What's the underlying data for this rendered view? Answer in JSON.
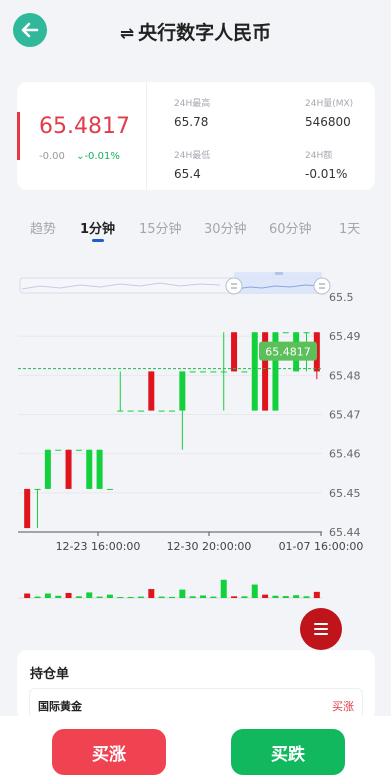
{
  "header": {
    "title": "央行数字人民币",
    "swap_glyph": "⇌",
    "back_icon": "arrow-left"
  },
  "quote": {
    "price": "65.4817",
    "change": "-0.00",
    "change_pct": "-0.01%",
    "stats": [
      {
        "label": "24H最高",
        "value": "65.78"
      },
      {
        "label": "24H量(MX)",
        "value": "546800"
      },
      {
        "label": "24H最低",
        "value": "65.4"
      },
      {
        "label": "24H额",
        "value": "-0.01%"
      }
    ]
  },
  "tabs": [
    {
      "label": "趋势",
      "active": false
    },
    {
      "label": "1分钟",
      "active": true
    },
    {
      "label": "15分钟",
      "active": false
    },
    {
      "label": "30分钟",
      "active": false
    },
    {
      "label": "60分钟",
      "active": false
    },
    {
      "label": "1天",
      "active": false
    }
  ],
  "colors": {
    "up": "#e0141c",
    "down": "#13d13c",
    "accent": "#1d5fc9",
    "back_button": "#2fb89a"
  },
  "chart_data": {
    "type": "candlestick",
    "y_ticks": [
      "65.5",
      "65.49",
      "65.48",
      "65.47",
      "65.46",
      "65.45",
      "65.44"
    ],
    "ylim": [
      65.44,
      65.5
    ],
    "x_ticks": [
      "12-23 16:00:00",
      "12-30 20:00:00",
      "01-07 16:00:00"
    ],
    "last_price_label": "65.4817",
    "last_price": 65.4817,
    "candles": [
      {
        "open": 65.441,
        "close": 65.451,
        "high": 65.451,
        "low": 65.441,
        "dir": "up"
      },
      {
        "open": 65.451,
        "close": 65.451,
        "high": 65.451,
        "low": 65.441,
        "dir": "flat"
      },
      {
        "open": 65.451,
        "close": 65.461,
        "high": 65.461,
        "low": 65.451,
        "dir": "down"
      },
      {
        "open": 65.461,
        "close": 65.461,
        "high": 65.461,
        "low": 65.461,
        "dir": "flat"
      },
      {
        "open": 65.461,
        "close": 65.451,
        "high": 65.461,
        "low": 65.451,
        "dir": "up"
      },
      {
        "open": 65.461,
        "close": 65.461,
        "high": 65.461,
        "low": 65.461,
        "dir": "flat"
      },
      {
        "open": 65.461,
        "close": 65.451,
        "high": 65.461,
        "low": 65.451,
        "dir": "down"
      },
      {
        "open": 65.451,
        "close": 65.461,
        "high": 65.461,
        "low": 65.451,
        "dir": "down"
      },
      {
        "open": 65.451,
        "close": 65.451,
        "high": 65.451,
        "low": 65.451,
        "dir": "flat"
      },
      {
        "open": 65.471,
        "close": 65.471,
        "high": 65.481,
        "low": 65.471,
        "dir": "flat"
      },
      {
        "open": 65.471,
        "close": 65.471,
        "high": 65.471,
        "low": 65.471,
        "dir": "flat"
      },
      {
        "open": 65.471,
        "close": 65.471,
        "high": 65.471,
        "low": 65.471,
        "dir": "flat"
      },
      {
        "open": 65.481,
        "close": 65.471,
        "high": 65.481,
        "low": 65.471,
        "dir": "up"
      },
      {
        "open": 65.471,
        "close": 65.471,
        "high": 65.471,
        "low": 65.471,
        "dir": "flat"
      },
      {
        "open": 65.471,
        "close": 65.471,
        "high": 65.471,
        "low": 65.471,
        "dir": "flat"
      },
      {
        "open": 65.471,
        "close": 65.481,
        "high": 65.481,
        "low": 65.461,
        "dir": "down"
      },
      {
        "open": 65.481,
        "close": 65.481,
        "high": 65.481,
        "low": 65.481,
        "dir": "flat"
      },
      {
        "open": 65.481,
        "close": 65.481,
        "high": 65.481,
        "low": 65.481,
        "dir": "flat"
      },
      {
        "open": 65.481,
        "close": 65.481,
        "high": 65.481,
        "low": 65.481,
        "dir": "flat"
      },
      {
        "open": 65.481,
        "close": 65.481,
        "high": 65.491,
        "low": 65.471,
        "dir": "flat"
      },
      {
        "open": 65.491,
        "close": 65.481,
        "high": 65.491,
        "low": 65.481,
        "dir": "up"
      },
      {
        "open": 65.481,
        "close": 65.481,
        "high": 65.481,
        "low": 65.481,
        "dir": "flat"
      },
      {
        "open": 65.471,
        "close": 65.491,
        "high": 65.491,
        "low": 65.471,
        "dir": "down"
      },
      {
        "open": 65.491,
        "close": 65.471,
        "high": 65.491,
        "low": 65.471,
        "dir": "up"
      },
      {
        "open": 65.471,
        "close": 65.491,
        "high": 65.491,
        "low": 65.471,
        "dir": "down"
      },
      {
        "open": 65.491,
        "close": 65.491,
        "high": 65.491,
        "low": 65.491,
        "dir": "flat"
      },
      {
        "open": 65.481,
        "close": 65.491,
        "high": 65.491,
        "low": 65.481,
        "dir": "down"
      },
      {
        "open": 65.491,
        "close": 65.491,
        "high": 65.491,
        "low": 65.481,
        "dir": "flat"
      },
      {
        "open": 65.491,
        "close": 65.481,
        "high": 65.491,
        "low": 65.479,
        "dir": "up"
      }
    ],
    "volumes": [
      0.16,
      0.05,
      0.16,
      0.08,
      0.18,
      0.06,
      0.2,
      0.05,
      0.12,
      0.01,
      0.02,
      0.05,
      0.32,
      0.05,
      0.04,
      0.3,
      0.06,
      0.09,
      0.05,
      0.65,
      0.06,
      0.06,
      0.48,
      0.12,
      0.08,
      0.07,
      0.1,
      0.06,
      0.22
    ]
  },
  "positions": {
    "title": "持仓单",
    "rows": [
      {
        "name": "国际黄金",
        "side": "买涨"
      }
    ]
  },
  "actions": {
    "buy_up": "买涨",
    "buy_down": "买跌"
  }
}
